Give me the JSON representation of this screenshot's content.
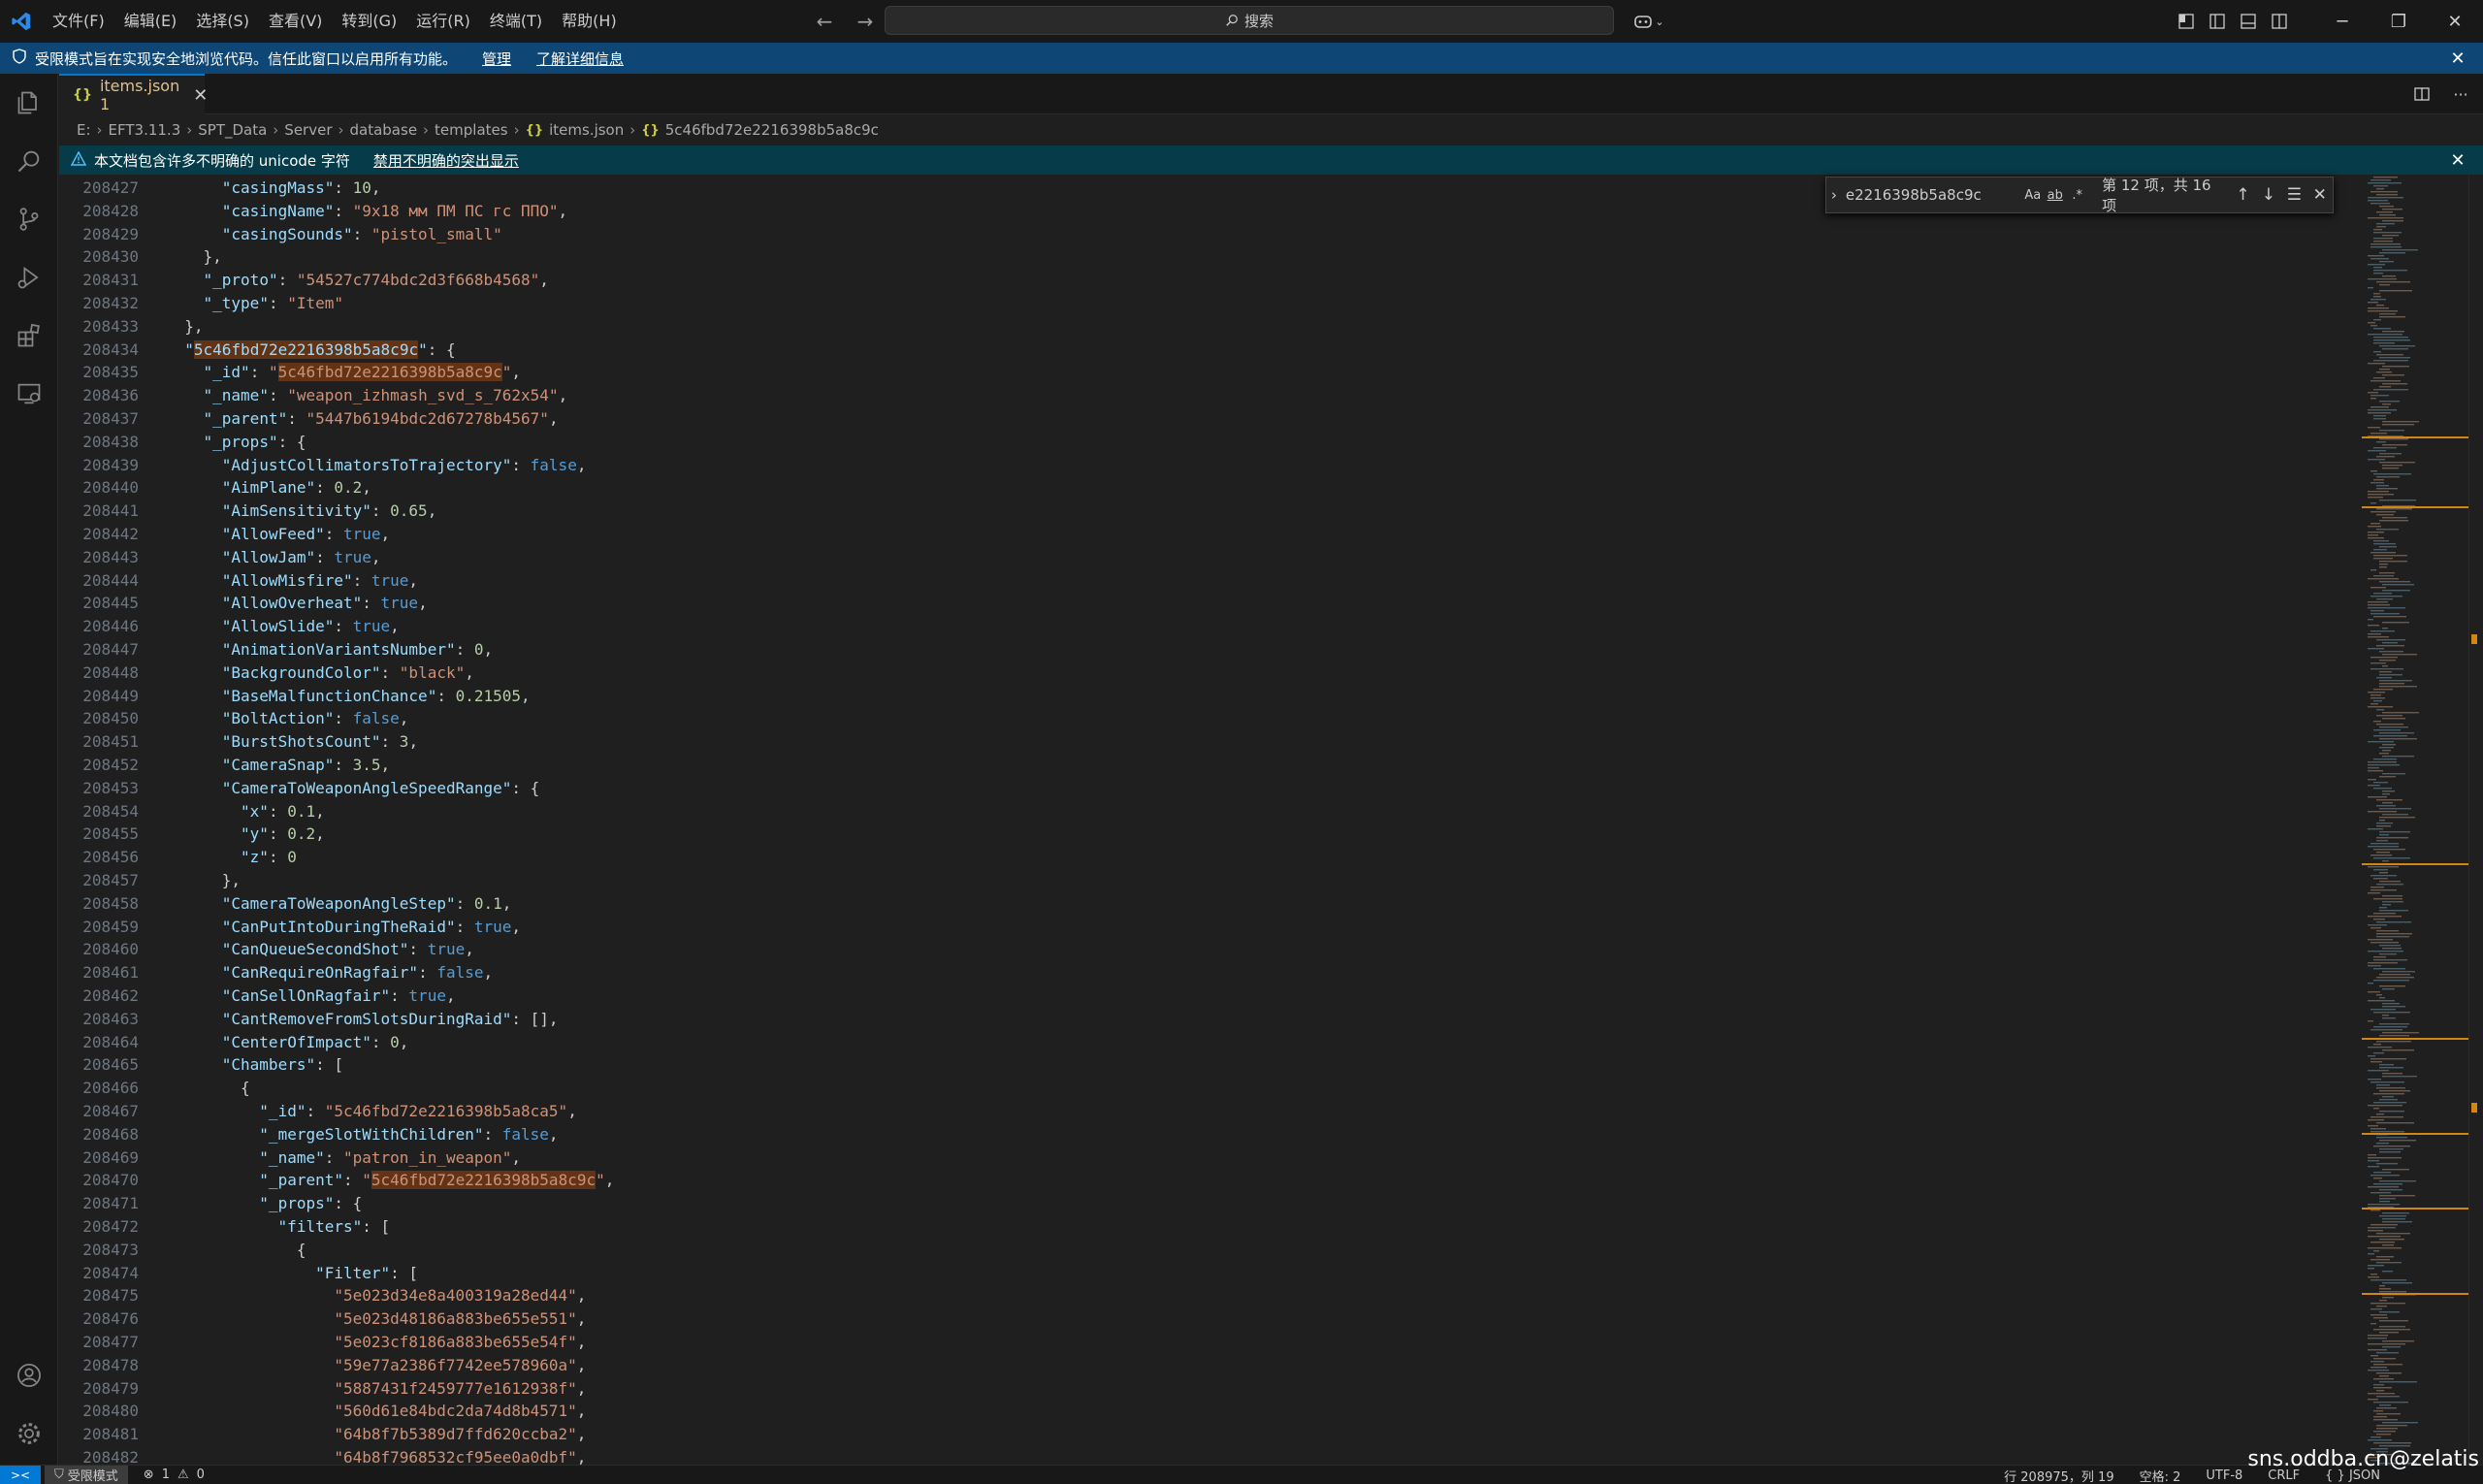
{
  "titlebar": {
    "menu": [
      "文件(F)",
      "编辑(E)",
      "选择(S)",
      "查看(V)",
      "转到(G)",
      "运行(R)",
      "终端(T)",
      "帮助(H)"
    ],
    "search_label": "搜索"
  },
  "restricted_banner": {
    "message": "受限模式旨在实现安全地浏览代码。信任此窗口以启用所有功能。",
    "manage": "管理",
    "learn_more": "了解详细信息"
  },
  "tab": {
    "label": "items.json 1"
  },
  "breadcrumb": [
    "E:",
    "EFT3.11.3",
    "SPT_Data",
    "Server",
    "database",
    "templates",
    "items.json",
    "5c46fbd72e2216398b5a8c9c"
  ],
  "unicode_banner": {
    "message": "本文档包含许多不明确的 unicode 字符",
    "action": "禁用不明确的突出显示"
  },
  "find_widget": {
    "query": "e2216398b5a8c9c",
    "match_case": "Aa",
    "whole_word": "ab",
    "regex": ".*",
    "result": "第 12 项，共 16 项"
  },
  "editor": {
    "lines": [
      {
        "num": "208427",
        "indent": 6,
        "parts": [
          [
            "k",
            "\"casingMass\""
          ],
          [
            "p",
            ": "
          ],
          [
            "n",
            "10"
          ],
          [
            "p",
            ","
          ]
        ]
      },
      {
        "num": "208428",
        "indent": 6,
        "parts": [
          [
            "k",
            "\"casingName\""
          ],
          [
            "p",
            ": "
          ],
          [
            "s",
            "\"9x18 мм ПМ ПС гс ППО\""
          ],
          [
            "p",
            ","
          ]
        ]
      },
      {
        "num": "208429",
        "indent": 6,
        "parts": [
          [
            "k",
            "\"casingSounds\""
          ],
          [
            "p",
            ": "
          ],
          [
            "s",
            "\"pistol_small\""
          ]
        ]
      },
      {
        "num": "208430",
        "indent": 4,
        "parts": [
          [
            "p",
            "},"
          ]
        ]
      },
      {
        "num": "208431",
        "indent": 4,
        "parts": [
          [
            "k",
            "\"_proto\""
          ],
          [
            "p",
            ": "
          ],
          [
            "s",
            "\"54527c774bdc2d3f668b4568\""
          ],
          [
            "p",
            ","
          ]
        ]
      },
      {
        "num": "208432",
        "indent": 4,
        "parts": [
          [
            "k",
            "\"_type\""
          ],
          [
            "p",
            ": "
          ],
          [
            "s",
            "\"Item\""
          ]
        ]
      },
      {
        "num": "208433",
        "indent": 2,
        "parts": [
          [
            "p",
            "},"
          ]
        ]
      },
      {
        "num": "208434",
        "indent": 2,
        "parts": [
          [
            "k",
            "\""
          ],
          [
            "khl",
            "5c46fbd72e2216398b5a8c9c"
          ],
          [
            "k",
            "\""
          ],
          [
            "p",
            ": {"
          ]
        ]
      },
      {
        "num": "208435",
        "indent": 4,
        "parts": [
          [
            "k",
            "\"_id\""
          ],
          [
            "p",
            ": "
          ],
          [
            "s",
            "\""
          ],
          [
            "shl",
            "5c46fbd72e2216398b5a8c9c"
          ],
          [
            "s",
            "\""
          ],
          [
            "p",
            ","
          ]
        ]
      },
      {
        "num": "208436",
        "indent": 4,
        "parts": [
          [
            "k",
            "\"_name\""
          ],
          [
            "p",
            ": "
          ],
          [
            "s",
            "\"weapon_izhmash_svd_s_762x54\""
          ],
          [
            "p",
            ","
          ]
        ]
      },
      {
        "num": "208437",
        "indent": 4,
        "parts": [
          [
            "k",
            "\"_parent\""
          ],
          [
            "p",
            ": "
          ],
          [
            "s",
            "\"5447b6194bdc2d67278b4567\""
          ],
          [
            "p",
            ","
          ]
        ]
      },
      {
        "num": "208438",
        "indent": 4,
        "parts": [
          [
            "k",
            "\"_props\""
          ],
          [
            "p",
            ": {"
          ]
        ]
      },
      {
        "num": "208439",
        "indent": 6,
        "parts": [
          [
            "k",
            "\"AdjustCollimatorsToTrajectory\""
          ],
          [
            "p",
            ": "
          ],
          [
            "b",
            "false"
          ],
          [
            "p",
            ","
          ]
        ]
      },
      {
        "num": "208440",
        "indent": 6,
        "parts": [
          [
            "k",
            "\"AimPlane\""
          ],
          [
            "p",
            ": "
          ],
          [
            "n",
            "0.2"
          ],
          [
            "p",
            ","
          ]
        ]
      },
      {
        "num": "208441",
        "indent": 6,
        "parts": [
          [
            "k",
            "\"AimSensitivity\""
          ],
          [
            "p",
            ": "
          ],
          [
            "n",
            "0.65"
          ],
          [
            "p",
            ","
          ]
        ]
      },
      {
        "num": "208442",
        "indent": 6,
        "parts": [
          [
            "k",
            "\"AllowFeed\""
          ],
          [
            "p",
            ": "
          ],
          [
            "b",
            "true"
          ],
          [
            "p",
            ","
          ]
        ]
      },
      {
        "num": "208443",
        "indent": 6,
        "parts": [
          [
            "k",
            "\"AllowJam\""
          ],
          [
            "p",
            ": "
          ],
          [
            "b",
            "true"
          ],
          [
            "p",
            ","
          ]
        ]
      },
      {
        "num": "208444",
        "indent": 6,
        "parts": [
          [
            "k",
            "\"AllowMisfire\""
          ],
          [
            "p",
            ": "
          ],
          [
            "b",
            "true"
          ],
          [
            "p",
            ","
          ]
        ]
      },
      {
        "num": "208445",
        "indent": 6,
        "parts": [
          [
            "k",
            "\"AllowOverheat\""
          ],
          [
            "p",
            ": "
          ],
          [
            "b",
            "true"
          ],
          [
            "p",
            ","
          ]
        ]
      },
      {
        "num": "208446",
        "indent": 6,
        "parts": [
          [
            "k",
            "\"AllowSlide\""
          ],
          [
            "p",
            ": "
          ],
          [
            "b",
            "true"
          ],
          [
            "p",
            ","
          ]
        ]
      },
      {
        "num": "208447",
        "indent": 6,
        "parts": [
          [
            "k",
            "\"AnimationVariantsNumber\""
          ],
          [
            "p",
            ": "
          ],
          [
            "n",
            "0"
          ],
          [
            "p",
            ","
          ]
        ]
      },
      {
        "num": "208448",
        "indent": 6,
        "parts": [
          [
            "k",
            "\"BackgroundColor\""
          ],
          [
            "p",
            ": "
          ],
          [
            "s",
            "\"black\""
          ],
          [
            "p",
            ","
          ]
        ]
      },
      {
        "num": "208449",
        "indent": 6,
        "parts": [
          [
            "k",
            "\"BaseMalfunctionChance\""
          ],
          [
            "p",
            ": "
          ],
          [
            "n",
            "0.21505"
          ],
          [
            "p",
            ","
          ]
        ]
      },
      {
        "num": "208450",
        "indent": 6,
        "parts": [
          [
            "k",
            "\"BoltAction\""
          ],
          [
            "p",
            ": "
          ],
          [
            "b",
            "false"
          ],
          [
            "p",
            ","
          ]
        ]
      },
      {
        "num": "208451",
        "indent": 6,
        "parts": [
          [
            "k",
            "\"BurstShotsCount\""
          ],
          [
            "p",
            ": "
          ],
          [
            "n",
            "3"
          ],
          [
            "p",
            ","
          ]
        ]
      },
      {
        "num": "208452",
        "indent": 6,
        "parts": [
          [
            "k",
            "\"CameraSnap\""
          ],
          [
            "p",
            ": "
          ],
          [
            "n",
            "3.5"
          ],
          [
            "p",
            ","
          ]
        ]
      },
      {
        "num": "208453",
        "indent": 6,
        "parts": [
          [
            "k",
            "\"CameraToWeaponAngleSpeedRange\""
          ],
          [
            "p",
            ": {"
          ]
        ]
      },
      {
        "num": "208454",
        "indent": 8,
        "parts": [
          [
            "k",
            "\"x\""
          ],
          [
            "p",
            ": "
          ],
          [
            "n",
            "0.1"
          ],
          [
            "p",
            ","
          ]
        ]
      },
      {
        "num": "208455",
        "indent": 8,
        "parts": [
          [
            "k",
            "\"y\""
          ],
          [
            "p",
            ": "
          ],
          [
            "n",
            "0.2"
          ],
          [
            "p",
            ","
          ]
        ]
      },
      {
        "num": "208456",
        "indent": 8,
        "parts": [
          [
            "k",
            "\"z\""
          ],
          [
            "p",
            ": "
          ],
          [
            "n",
            "0"
          ]
        ]
      },
      {
        "num": "208457",
        "indent": 6,
        "parts": [
          [
            "p",
            "},"
          ]
        ]
      },
      {
        "num": "208458",
        "indent": 6,
        "parts": [
          [
            "k",
            "\"CameraToWeaponAngleStep\""
          ],
          [
            "p",
            ": "
          ],
          [
            "n",
            "0.1"
          ],
          [
            "p",
            ","
          ]
        ]
      },
      {
        "num": "208459",
        "indent": 6,
        "parts": [
          [
            "k",
            "\"CanPutIntoDuringTheRaid\""
          ],
          [
            "p",
            ": "
          ],
          [
            "b",
            "true"
          ],
          [
            "p",
            ","
          ]
        ]
      },
      {
        "num": "208460",
        "indent": 6,
        "parts": [
          [
            "k",
            "\"CanQueueSecondShot\""
          ],
          [
            "p",
            ": "
          ],
          [
            "b",
            "true"
          ],
          [
            "p",
            ","
          ]
        ]
      },
      {
        "num": "208461",
        "indent": 6,
        "parts": [
          [
            "k",
            "\"CanRequireOnRagfair\""
          ],
          [
            "p",
            ": "
          ],
          [
            "b",
            "false"
          ],
          [
            "p",
            ","
          ]
        ]
      },
      {
        "num": "208462",
        "indent": 6,
        "parts": [
          [
            "k",
            "\"CanSellOnRagfair\""
          ],
          [
            "p",
            ": "
          ],
          [
            "b",
            "true"
          ],
          [
            "p",
            ","
          ]
        ]
      },
      {
        "num": "208463",
        "indent": 6,
        "parts": [
          [
            "k",
            "\"CantRemoveFromSlotsDuringRaid\""
          ],
          [
            "p",
            ": [],"
          ]
        ]
      },
      {
        "num": "208464",
        "indent": 6,
        "parts": [
          [
            "k",
            "\"CenterOfImpact\""
          ],
          [
            "p",
            ": "
          ],
          [
            "n",
            "0"
          ],
          [
            "p",
            ","
          ]
        ]
      },
      {
        "num": "208465",
        "indent": 6,
        "parts": [
          [
            "k",
            "\"Chambers\""
          ],
          [
            "p",
            ": ["
          ]
        ]
      },
      {
        "num": "208466",
        "indent": 8,
        "parts": [
          [
            "p",
            "{"
          ]
        ]
      },
      {
        "num": "208467",
        "indent": 10,
        "parts": [
          [
            "k",
            "\"_id\""
          ],
          [
            "p",
            ": "
          ],
          [
            "s",
            "\"5c46fbd72e2216398b5a8ca5\""
          ],
          [
            "p",
            ","
          ]
        ]
      },
      {
        "num": "208468",
        "indent": 10,
        "parts": [
          [
            "k",
            "\"_mergeSlotWithChildren\""
          ],
          [
            "p",
            ": "
          ],
          [
            "b",
            "false"
          ],
          [
            "p",
            ","
          ]
        ]
      },
      {
        "num": "208469",
        "indent": 10,
        "parts": [
          [
            "k",
            "\"_name\""
          ],
          [
            "p",
            ": "
          ],
          [
            "s",
            "\"patron_in_weapon\""
          ],
          [
            "p",
            ","
          ]
        ]
      },
      {
        "num": "208470",
        "indent": 10,
        "parts": [
          [
            "k",
            "\"_parent\""
          ],
          [
            "p",
            ": "
          ],
          [
            "s",
            "\""
          ],
          [
            "shl",
            "5c46fbd72e2216398b5a8c9c"
          ],
          [
            "s",
            "\""
          ],
          [
            "p",
            ","
          ]
        ]
      },
      {
        "num": "208471",
        "indent": 10,
        "parts": [
          [
            "k",
            "\"_props\""
          ],
          [
            "p",
            ": {"
          ]
        ]
      },
      {
        "num": "208472",
        "indent": 12,
        "parts": [
          [
            "k",
            "\"filters\""
          ],
          [
            "p",
            ": ["
          ]
        ]
      },
      {
        "num": "208473",
        "indent": 14,
        "parts": [
          [
            "p",
            "{"
          ]
        ]
      },
      {
        "num": "208474",
        "indent": 16,
        "parts": [
          [
            "k",
            "\"Filter\""
          ],
          [
            "p",
            ": ["
          ]
        ]
      },
      {
        "num": "208475",
        "indent": 18,
        "parts": [
          [
            "s",
            "\"5e023d34e8a400319a28ed44\""
          ],
          [
            "p",
            ","
          ]
        ]
      },
      {
        "num": "208476",
        "indent": 18,
        "parts": [
          [
            "s",
            "\"5e023d48186a883be655e551\""
          ],
          [
            "p",
            ","
          ]
        ]
      },
      {
        "num": "208477",
        "indent": 18,
        "parts": [
          [
            "s",
            "\"5e023cf8186a883be655e54f\""
          ],
          [
            "p",
            ","
          ]
        ]
      },
      {
        "num": "208478",
        "indent": 18,
        "parts": [
          [
            "s",
            "\"59e77a2386f7742ee578960a\""
          ],
          [
            "p",
            ","
          ]
        ]
      },
      {
        "num": "208479",
        "indent": 18,
        "parts": [
          [
            "s",
            "\"5887431f2459777e1612938f\""
          ],
          [
            "p",
            ","
          ]
        ]
      },
      {
        "num": "208480",
        "indent": 18,
        "parts": [
          [
            "s",
            "\"560d61e84bdc2da74d8b4571\""
          ],
          [
            "p",
            ","
          ]
        ]
      },
      {
        "num": "208481",
        "indent": 18,
        "parts": [
          [
            "s",
            "\"64b8f7b5389d7ffd620ccba2\""
          ],
          [
            "p",
            ","
          ]
        ]
      },
      {
        "num": "208482",
        "indent": 18,
        "parts": [
          [
            "s",
            "\"64b8f7968532cf95ee0a0dbf\""
          ],
          [
            "p",
            ","
          ]
        ]
      }
    ]
  },
  "statusbar": {
    "restricted_mode": "受限模式",
    "errors": "1",
    "warnings": "0",
    "position": "行 208975，列 19",
    "spaces": "空格: 2",
    "encoding": "UTF-8",
    "eol": "CRLF",
    "language": "JSON"
  },
  "watermark": "sns.oddba.cn@zelatis",
  "colors": {
    "accent": "#0078d4",
    "restricted_banner": "#0e4775",
    "unicode_banner": "#063b49",
    "find_highlight": "#623315"
  }
}
